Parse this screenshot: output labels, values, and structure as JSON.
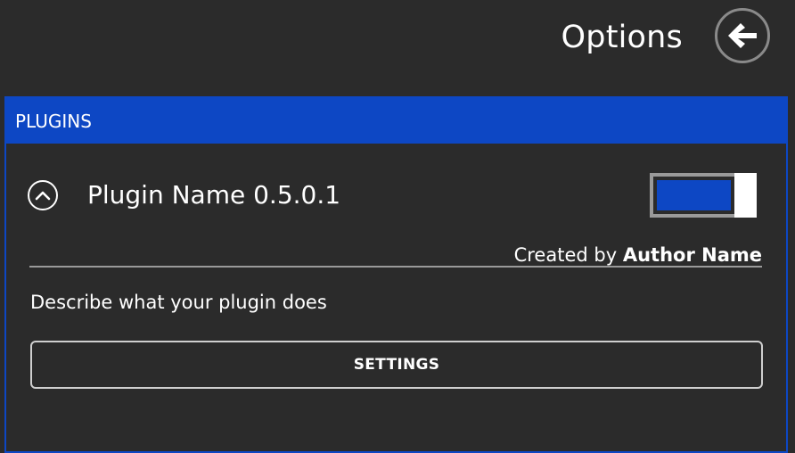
{
  "header": {
    "title": "Options",
    "back_icon": "arrow-left-icon"
  },
  "plugins_panel": {
    "title": "PLUGINS",
    "accent_color": "#0d47c4",
    "plugin": {
      "collapse_icon": "chevron-up-icon",
      "name": "Plugin Name",
      "version": "0.5.0.1",
      "name_with_version": "Plugin Name 0.5.0.1",
      "enabled": true,
      "credit_prefix": "Created by",
      "author": "Author Name",
      "description": "Describe what your plugin does",
      "settings_label": "SETTINGS"
    }
  }
}
